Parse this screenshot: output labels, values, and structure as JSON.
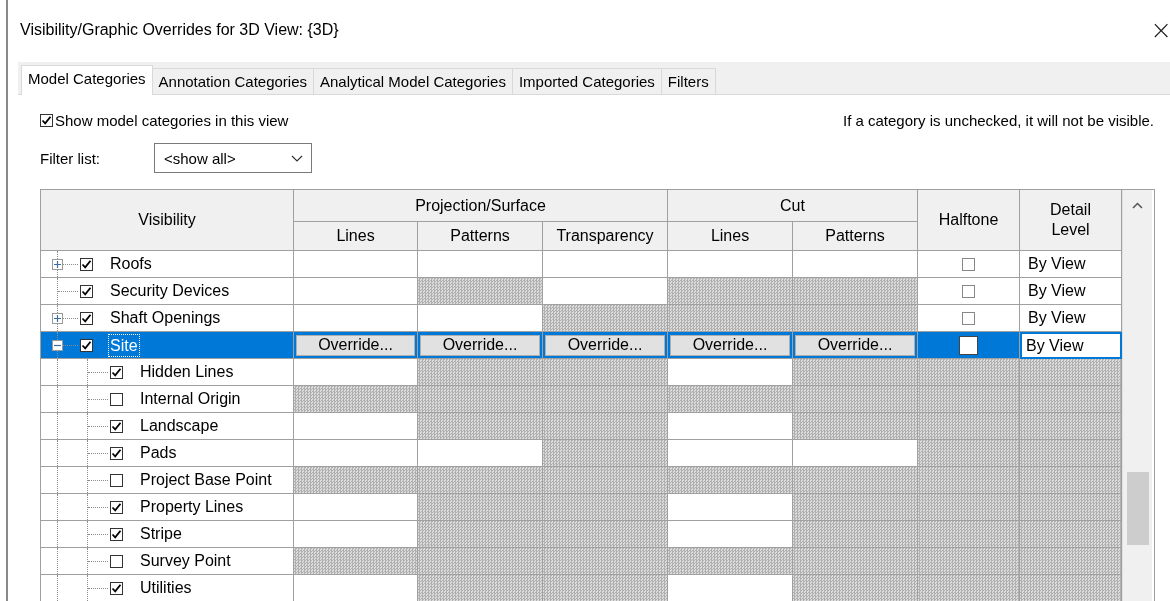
{
  "window": {
    "title": "Visibility/Graphic Overrides for 3D View: {3D}",
    "close": "×"
  },
  "tabs": [
    {
      "label": "Model Categories",
      "selected": true
    },
    {
      "label": "Annotation Categories",
      "selected": false
    },
    {
      "label": "Analytical Model Categories",
      "selected": false
    },
    {
      "label": "Imported Categories",
      "selected": false
    },
    {
      "label": "Filters",
      "selected": false
    }
  ],
  "show_categories": {
    "label": "Show model categories in this view",
    "checked": true
  },
  "info": "If a category is unchecked, it will not be visible.",
  "filter": {
    "label": "Filter list:",
    "value": "<show all>"
  },
  "table": {
    "headers": [
      {
        "label": "Visibility"
      },
      {
        "label": "Projection/Surface",
        "children": [
          {
            "label": "Lines"
          },
          {
            "label": "Patterns"
          },
          {
            "label": "Transparency"
          }
        ]
      },
      {
        "label": "Cut",
        "children": [
          {
            "label": "Lines"
          },
          {
            "label": "Patterns"
          }
        ]
      },
      {
        "label": "Halftone"
      },
      {
        "label": "Detail Level"
      }
    ],
    "rows": [
      {
        "label": "Roofs",
        "checked": true,
        "expanded": false,
        "selected": false,
        "cells": [
          {
            "kind": "empty"
          },
          {
            "kind": "empty"
          },
          {
            "kind": "empty"
          },
          {
            "kind": "empty"
          },
          {
            "kind": "empty"
          },
          {
            "kind": "checkbox",
            "checked": false
          },
          {
            "kind": "text",
            "text": "By View"
          }
        ]
      },
      {
        "label": "Security Devices",
        "checked": true,
        "selected": false,
        "cells": [
          {
            "kind": "empty"
          },
          {
            "kind": "hatched"
          },
          {
            "kind": "empty"
          },
          {
            "kind": "hatched"
          },
          {
            "kind": "hatched"
          },
          {
            "kind": "checkbox",
            "checked": false
          },
          {
            "kind": "text",
            "text": "By View"
          }
        ]
      },
      {
        "label": "Shaft Openings",
        "checked": true,
        "expanded": false,
        "selected": false,
        "cells": [
          {
            "kind": "empty"
          },
          {
            "kind": "empty"
          },
          {
            "kind": "hatched"
          },
          {
            "kind": "hatched"
          },
          {
            "kind": "hatched"
          },
          {
            "kind": "checkbox",
            "checked": false
          },
          {
            "kind": "text",
            "text": "By View"
          }
        ]
      },
      {
        "label": "Site",
        "checked": true,
        "expanded": true,
        "selected": true,
        "cells": [
          {
            "kind": "button",
            "text": "Override..."
          },
          {
            "kind": "button",
            "text": "Override..."
          },
          {
            "kind": "button",
            "text": "Override..."
          },
          {
            "kind": "button",
            "text": "Override..."
          },
          {
            "kind": "button",
            "text": "Override..."
          },
          {
            "kind": "checkbox",
            "checked": false
          },
          {
            "kind": "field",
            "text": "By View"
          }
        ],
        "children": [
          {
            "label": "Hidden Lines",
            "checked": true,
            "selected": false,
            "cells": [
              {
                "kind": "empty"
              },
              {
                "kind": "hatched"
              },
              {
                "kind": "hatched"
              },
              {
                "kind": "empty"
              },
              {
                "kind": "hatched"
              },
              {
                "kind": "hatched"
              },
              {
                "kind": "hatched"
              }
            ]
          },
          {
            "label": "Internal Origin",
            "checked": false,
            "selected": false,
            "cells": [
              {
                "kind": "hatched"
              },
              {
                "kind": "hatched"
              },
              {
                "kind": "hatched"
              },
              {
                "kind": "hatched"
              },
              {
                "kind": "hatched"
              },
              {
                "kind": "hatched"
              },
              {
                "kind": "hatched"
              }
            ]
          },
          {
            "label": "Landscape",
            "checked": true,
            "selected": false,
            "cells": [
              {
                "kind": "empty"
              },
              {
                "kind": "hatched"
              },
              {
                "kind": "hatched"
              },
              {
                "kind": "empty"
              },
              {
                "kind": "hatched"
              },
              {
                "kind": "hatched"
              },
              {
                "kind": "hatched"
              }
            ]
          },
          {
            "label": "Pads",
            "checked": true,
            "selected": false,
            "cells": [
              {
                "kind": "empty"
              },
              {
                "kind": "empty"
              },
              {
                "kind": "hatched"
              },
              {
                "kind": "empty"
              },
              {
                "kind": "empty"
              },
              {
                "kind": "hatched"
              },
              {
                "kind": "hatched"
              }
            ]
          },
          {
            "label": "Project Base Point",
            "checked": false,
            "selected": false,
            "cells": [
              {
                "kind": "hatched"
              },
              {
                "kind": "hatched"
              },
              {
                "kind": "hatched"
              },
              {
                "kind": "hatched"
              },
              {
                "kind": "hatched"
              },
              {
                "kind": "hatched"
              },
              {
                "kind": "hatched"
              }
            ]
          },
          {
            "label": "Property Lines",
            "checked": true,
            "selected": false,
            "cells": [
              {
                "kind": "empty"
              },
              {
                "kind": "hatched"
              },
              {
                "kind": "hatched"
              },
              {
                "kind": "empty"
              },
              {
                "kind": "hatched"
              },
              {
                "kind": "hatched"
              },
              {
                "kind": "hatched"
              }
            ]
          },
          {
            "label": "Stripe",
            "checked": true,
            "selected": false,
            "cells": [
              {
                "kind": "empty"
              },
              {
                "kind": "hatched"
              },
              {
                "kind": "hatched"
              },
              {
                "kind": "empty"
              },
              {
                "kind": "hatched"
              },
              {
                "kind": "hatched"
              },
              {
                "kind": "hatched"
              }
            ]
          },
          {
            "label": "Survey Point",
            "checked": false,
            "selected": false,
            "cells": [
              {
                "kind": "hatched"
              },
              {
                "kind": "hatched"
              },
              {
                "kind": "hatched"
              },
              {
                "kind": "hatched"
              },
              {
                "kind": "hatched"
              },
              {
                "kind": "hatched"
              },
              {
                "kind": "hatched"
              }
            ]
          },
          {
            "label": "Utilities",
            "checked": true,
            "selected": false,
            "cells": [
              {
                "kind": "empty"
              },
              {
                "kind": "hatched"
              },
              {
                "kind": "hatched"
              },
              {
                "kind": "empty"
              },
              {
                "kind": "hatched"
              },
              {
                "kind": "hatched"
              },
              {
                "kind": "hatched"
              }
            ]
          }
        ]
      }
    ]
  }
}
